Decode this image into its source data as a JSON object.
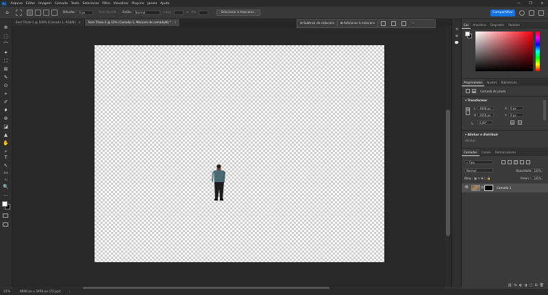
{
  "app": {
    "logo": "Ps"
  },
  "menu": [
    "Arquivo",
    "Editar",
    "Imagem",
    "Camada",
    "Texto",
    "Selecionar",
    "Filtro",
    "Visualizar",
    "Plug-ins",
    "Janela",
    "Ajuda"
  ],
  "window_buttons": [
    "—",
    "❐",
    "✕"
  ],
  "options": {
    "feather_label": "Difusão:",
    "feather_value": "0 px",
    "antialias_label": "Sem Serrilh.",
    "style_label": "Estilo:",
    "style_value": "Normal",
    "width_label": "Larg.:",
    "height_label": "Alt.:",
    "select_mask_button": "Selecionar e mascarar...",
    "share_button": "Compartilhar"
  },
  "tabs": [
    {
      "label": "Sem Título-1 @ 100% (Camada 1, RGB/8)",
      "close": "×"
    },
    {
      "label": "Sem Título-2 @ 22% (Camada 1, Máscara de camada/8) *",
      "close": "×"
    }
  ],
  "mask_bar": {
    "subtract": "Subtrair da máscara",
    "add": "Adicionar à máscara"
  },
  "tools": [
    "⊕",
    "⬚",
    "⌒",
    "✦",
    "⛶",
    "⊠",
    "✎",
    "⊙",
    "⌖",
    "✐",
    "♦",
    "⊗",
    "◪",
    "▲",
    "✋",
    "⌕",
    "T",
    "↖",
    "▭",
    "☜",
    "🔍",
    "…"
  ],
  "color_panel": {
    "tabs": [
      "Cor",
      "Amostras",
      "Degradês",
      "Padrões"
    ]
  },
  "properties_panel": {
    "tabs": [
      "Propriedades",
      "Ajustes",
      "Bibliotecas"
    ],
    "layer_type": "Camada de pixels",
    "transform_label": "Transformar",
    "w_label": "L",
    "w_value": "4608 px",
    "h_label": "A",
    "h_value": "2656 px",
    "x_label": "X",
    "x_value": "0 px",
    "y_label": "Y",
    "y_value": "0 px",
    "angle_value": "0,00°",
    "align_label": "Alinhar e distribuir",
    "align_sub": "Alinhar:"
  },
  "layers_panel": {
    "tabs": [
      "Camadas",
      "Canais",
      "Demarcadores"
    ],
    "filter_value": "Tipo",
    "blend_mode": "Normal",
    "opacity_label": "Opacidade:",
    "opacity_value": "100%",
    "lock_label": "Bloq.:",
    "fill_label": "Preen.:",
    "fill_value": "100%",
    "layer_name": "Camada 1",
    "bottom_icons": [
      "⛓",
      "fx",
      "◐",
      "◑",
      "▢",
      "⊞",
      "🗑"
    ]
  },
  "status": {
    "zoom": "22%",
    "doc_size": "4608 px x 3456 px (72 ppi)",
    "arrow": "›"
  },
  "colors": {
    "accent": "#1473e6",
    "canvas_bg": "#282828",
    "panel_bg": "#3a3a3a"
  }
}
